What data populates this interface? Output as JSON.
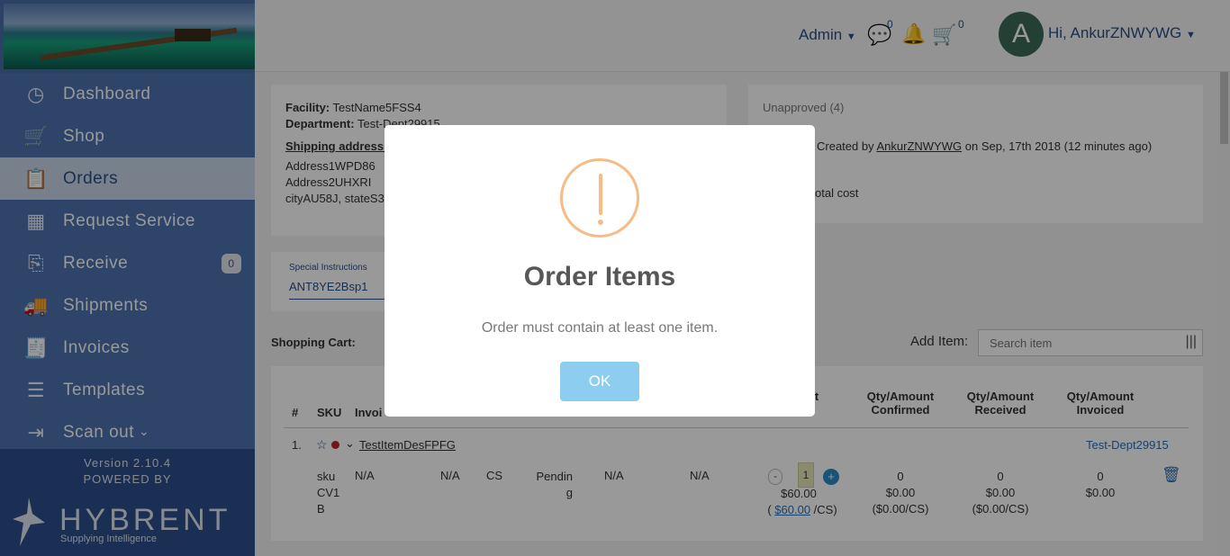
{
  "sidebar": {
    "items": [
      {
        "label": "Dashboard",
        "icon": "dashboard-icon"
      },
      {
        "label": "Shop",
        "icon": "cart-icon"
      },
      {
        "label": "Orders",
        "icon": "orders-icon"
      },
      {
        "label": "Request Service",
        "icon": "service-icon"
      },
      {
        "label": "Receive",
        "icon": "receive-icon",
        "badge": "0"
      },
      {
        "label": "Shipments",
        "icon": "truck-icon"
      },
      {
        "label": "Invoices",
        "icon": "invoice-icon"
      },
      {
        "label": "Templates",
        "icon": "templates-icon"
      },
      {
        "label": "Scan out",
        "icon": "scan-out-icon"
      }
    ],
    "version": "Version 2.10.4",
    "powered_by": "POWERED BY",
    "brand": "HYBRENT",
    "tagline": "Supplying Intelligence"
  },
  "header": {
    "admin": "Admin",
    "messages_count": "0",
    "cart_count": "0",
    "avatar_letter": "A",
    "greeting": "Hi, AnkurZNWYWG"
  },
  "order": {
    "facility_label": "Facility:",
    "facility": "TestName5FSS4",
    "department_label": "Department:",
    "department": "Test-Dept29915",
    "shipping_label": "Shipping address:",
    "address1": "Address1WPD86",
    "address2": "Address2UHXRI",
    "address3": "cityAU58J, stateS3I",
    "status": "Unapproved (4)",
    "created_prefix": "Created by",
    "created_by": "AnkurZNWYWG",
    "created_suffix": "on Sep, 17th 2018 (12 minutes ago)",
    "total_cost": "otal cost",
    "special_label": "Special Instructions",
    "special_value": "ANT8YE2Bsp1"
  },
  "cart": {
    "title": "Shopping Cart:",
    "add_item_label": "Add Item:",
    "search_placeholder": "Search item",
    "headers": {
      "num": "#",
      "sku": "SKU",
      "invoice": "Invoi",
      "amount": "ount",
      "confirmed": "Qty/Amount Confirmed",
      "received": "Qty/Amount Received",
      "invoiced": "Qty/Amount Invoiced"
    },
    "row": {
      "num": "1.",
      "item": "TestItemDesFPFG",
      "dept": "Test-Dept29915",
      "sku": "sku CV1 B",
      "na1": "N/A",
      "na2": "N/A",
      "unit": "CS",
      "status": "Pending",
      "na3": "N/A",
      "na4": "N/A",
      "qty": "1",
      "price": "$60.00",
      "per_pre": "(",
      "per_link": "$60.00",
      "per_post": "/CS)",
      "conf_qty": "0",
      "conf_amt": "$0.00",
      "conf_per": "($0.00/CS)",
      "rec_qty": "0",
      "rec_amt": "$0.00",
      "rec_per": "($0.00/CS)",
      "inv_qty": "0",
      "inv_amt": "$0.00"
    }
  },
  "modal": {
    "title": "Order Items",
    "message": "Order must contain at least one item.",
    "ok": "OK"
  },
  "colors": {
    "sidebar": "#4a6ea8",
    "accent": "#2a4f86",
    "warning": "#f8bb86",
    "ok_button": "#8ccdf0"
  }
}
